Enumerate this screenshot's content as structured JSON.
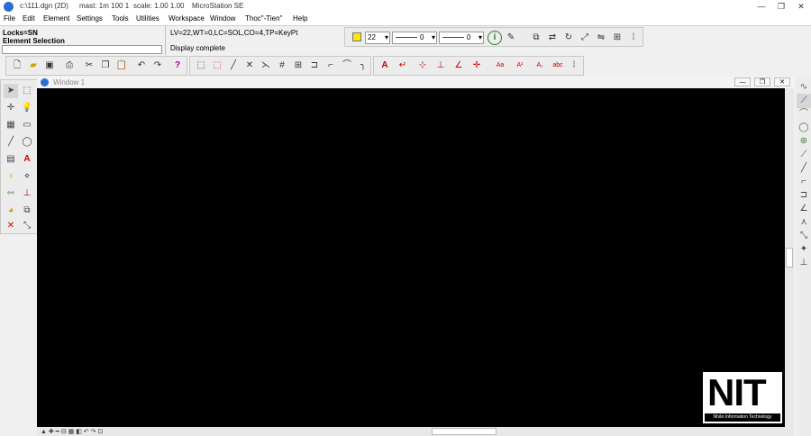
{
  "titlebar": {
    "segments": [
      "c:\\111.dgn (2D)",
      "mast: 1m 100 1",
      "scale: 1.00 1.00",
      "MicroStation SE"
    ],
    "minimize": "—",
    "restore": "❐",
    "close": "✕"
  },
  "menubar": {
    "items": [
      "File",
      "Edit",
      "Element",
      "Settings",
      "Tools",
      "Utilities",
      "Workspace",
      "Window",
      "Thoc\"-Tien\"",
      "Help"
    ]
  },
  "status": {
    "locks": "Locks=SN",
    "tool": "Element Selection",
    "attributes": "LV=22,WT=0,LC=SOL,CO=4,TP=KeyPt",
    "message": "Display complete"
  },
  "attributes_bar": {
    "color_value": "22",
    "line_style_value": "0",
    "weight_value": "0",
    "color_swatch": "#ffe600"
  },
  "view_window": {
    "title": "Window 1",
    "canvas_color": "#000000"
  },
  "logo": {
    "mark": "NIT",
    "tagline": "Nhân Information Technology"
  },
  "icons": {
    "standard": [
      "new-file-icon",
      "open-folder-icon",
      "save-icon",
      "print-icon",
      "cut-icon",
      "copy-icon",
      "paste-icon",
      "undo-icon",
      "redo-icon",
      "help-icon"
    ],
    "main_row2": [
      "place-fence-icon",
      "delete-fence-icon",
      "line-icon",
      "intersect-icon",
      "extend-icon",
      "trim-icon",
      "fillet-icon",
      "chamfer-icon",
      "modify-icon",
      "arc-icon",
      "partial-delete-icon"
    ],
    "text_row2": [
      "text-icon",
      "text-node-icon",
      "dimension-icon",
      "dim-linear-icon",
      "dim-angle-icon",
      "dim-radius-icon",
      "text-edit-icon",
      "text-match-icon",
      "text-spell-icon",
      "text-find-icon",
      "text-format-icon"
    ],
    "attr_right": [
      "info-icon",
      "pen-icon",
      "copy-element-icon",
      "move-element-icon",
      "rotate-element-icon",
      "scale-element-icon",
      "mirror-element-icon",
      "array-element-icon",
      "grid-icon"
    ]
  }
}
